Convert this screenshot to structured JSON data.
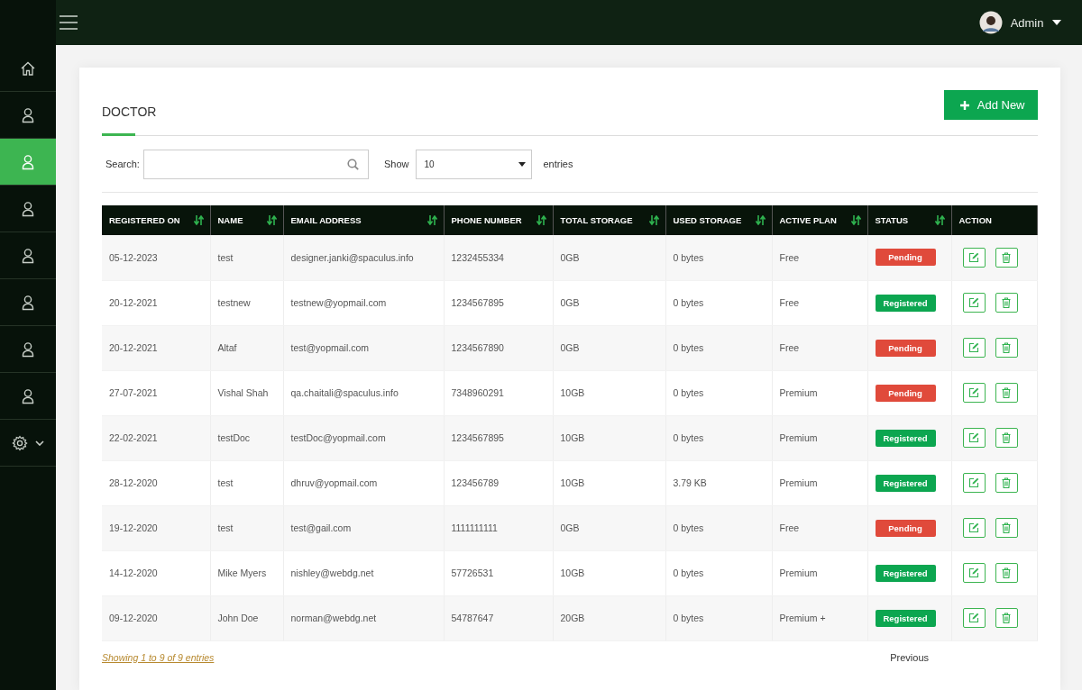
{
  "topbar": {
    "user": "Admin"
  },
  "sidebar": {
    "items": [
      {
        "kind": "home",
        "selected": false
      },
      {
        "kind": "user",
        "selected": false
      },
      {
        "kind": "user",
        "selected": true
      },
      {
        "kind": "user",
        "selected": false
      },
      {
        "kind": "user",
        "selected": false
      },
      {
        "kind": "user",
        "selected": false
      },
      {
        "kind": "user",
        "selected": false
      },
      {
        "kind": "user",
        "selected": false
      },
      {
        "kind": "settings",
        "selected": false
      }
    ]
  },
  "page": {
    "title": "DOCTOR",
    "add_button": "Add New"
  },
  "filters": {
    "search_label": "Search:",
    "show_label": "Show",
    "page_size": "10",
    "entries_label": "entries"
  },
  "table": {
    "columns": [
      {
        "label": "REGISTERED ON",
        "sortable": true
      },
      {
        "label": "NAME",
        "sortable": true
      },
      {
        "label": "EMAIL ADDRESS",
        "sortable": true
      },
      {
        "label": "PHONE NUMBER",
        "sortable": true
      },
      {
        "label": "TOTAL STORAGE",
        "sortable": true
      },
      {
        "label": "USED STORAGE",
        "sortable": true
      },
      {
        "label": "ACTIVE PLAN",
        "sortable": true
      },
      {
        "label": "STATUS",
        "sortable": true
      },
      {
        "label": "ACTION",
        "sortable": false
      }
    ],
    "rows": [
      {
        "cells": [
          "05-12-2023",
          "test",
          "designer.janki@spaculus.info",
          "1232455334",
          "0GB",
          "0 bytes",
          "Free"
        ],
        "status": {
          "label": "Pending",
          "kind": "pending"
        }
      },
      {
        "cells": [
          "20-12-2021",
          "testnew",
          "testnew@yopmail.com",
          "1234567895",
          "0GB",
          "0 bytes",
          "Free"
        ],
        "status": {
          "label": "Registered",
          "kind": "registered"
        }
      },
      {
        "cells": [
          "20-12-2021",
          "Altaf",
          "test@yopmail.com",
          "1234567890",
          "0GB",
          "0 bytes",
          "Free"
        ],
        "status": {
          "label": "Pending",
          "kind": "pending"
        }
      },
      {
        "cells": [
          "27-07-2021",
          "Vishal Shah",
          "qa.chaitali@spaculus.info",
          "7348960291",
          "10GB",
          "0 bytes",
          "Premium"
        ],
        "status": {
          "label": "Pending",
          "kind": "pending"
        }
      },
      {
        "cells": [
          "22-02-2021",
          "testDoc",
          "testDoc@yopmail.com",
          "1234567895",
          "10GB",
          "0 bytes",
          "Premium"
        ],
        "status": {
          "label": "Registered",
          "kind": "registered"
        }
      },
      {
        "cells": [
          "28-12-2020",
          "test",
          "dhruv@yopmail.com",
          "123456789",
          "10GB",
          "3.79 KB",
          "Premium"
        ],
        "status": {
          "label": "Registered",
          "kind": "registered"
        }
      },
      {
        "cells": [
          "19-12-2020",
          "test",
          "test@gail.com",
          "1111111111",
          "0GB",
          "0 bytes",
          "Free"
        ],
        "status": {
          "label": "Pending",
          "kind": "pending"
        }
      },
      {
        "cells": [
          "14-12-2020",
          "Mike Myers",
          "nishley@webdg.net",
          "57726531",
          "10GB",
          "0 bytes",
          "Premium"
        ],
        "status": {
          "label": "Registered",
          "kind": "registered"
        }
      },
      {
        "cells": [
          "09-12-2020",
          "John Doe",
          "norman@webdg.net",
          "54787647",
          "20GB",
          "0 bytes",
          "Premium +"
        ],
        "status": {
          "label": "Registered",
          "kind": "registered"
        }
      }
    ]
  },
  "footer": {
    "info": "Showing 1 to 9 of 9 entries",
    "previous": "Previous"
  }
}
